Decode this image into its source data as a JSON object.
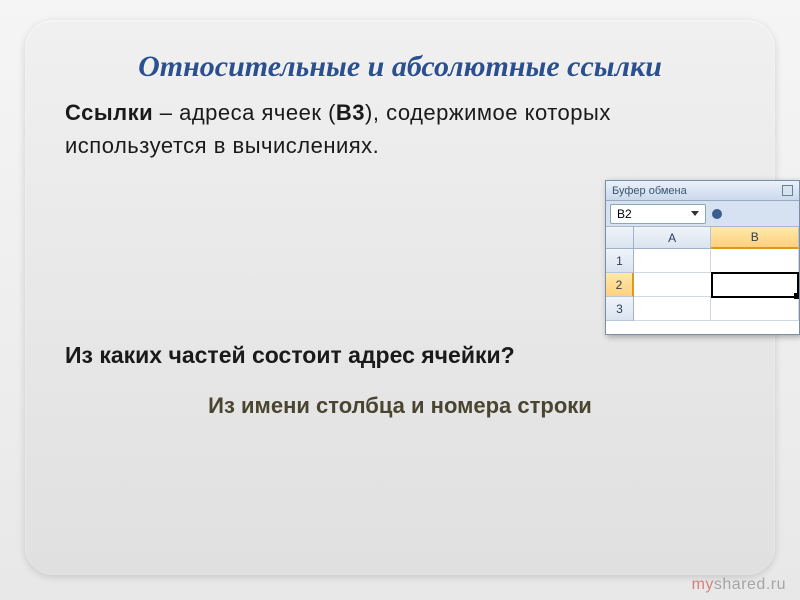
{
  "title": "Относительные и абсолютные ссылки",
  "body": {
    "lead_bold": "Ссылки",
    "after_lead": " – адреса ячеек (",
    "cell_ref": "В3",
    "tail": "), содержимое которых используется в вычислениях."
  },
  "question": "Из каких частей состоит адрес ячейки?",
  "answer": "Из имени столбца и номера строки",
  "excel": {
    "clipboard_label": "Буфер обмена",
    "namebox_value": "B2",
    "columns": [
      "A",
      "B"
    ],
    "rows": [
      "1",
      "2",
      "3"
    ],
    "active_col": "B",
    "active_row": "2"
  },
  "watermark": {
    "prefix": "my",
    "suffix": "shared.ru"
  }
}
